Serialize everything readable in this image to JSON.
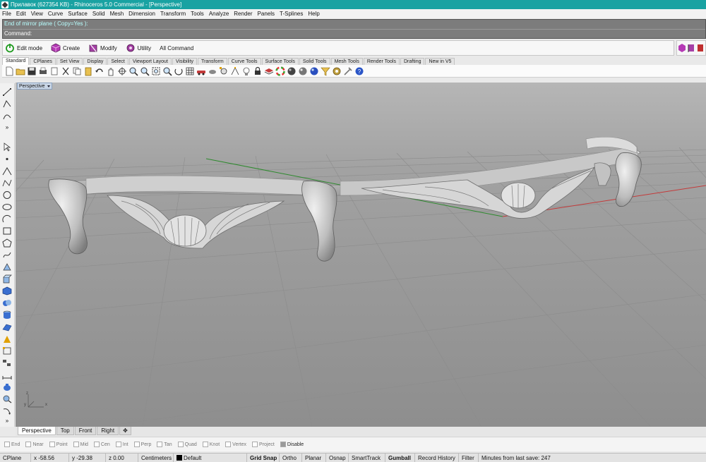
{
  "window": {
    "title": "Прилавок (627354 KB) - Rhinoceros 5.0 Commercial - [Perspective]"
  },
  "menu": [
    "File",
    "Edit",
    "View",
    "Curve",
    "Surface",
    "Solid",
    "Mesh",
    "Dimension",
    "Transform",
    "Tools",
    "Analyze",
    "Render",
    "Panels",
    "T-Splines",
    "Help"
  ],
  "command": {
    "history": "End of mirror plane ( Copy=Yes ):",
    "prompt": "Command:"
  },
  "modes": {
    "edit": "Edit mode",
    "create": "Create",
    "modify": "Modify",
    "utility": "Utility",
    "all": "All Command"
  },
  "tabs": [
    "Standard",
    "CPlanes",
    "Set View",
    "Display",
    "Select",
    "Viewport Layout",
    "Visibility",
    "Transform",
    "Curve Tools",
    "Surface Tools",
    "Solid Tools",
    "Mesh Tools",
    "Render Tools",
    "Drafting",
    "New in V5"
  ],
  "viewport": {
    "label": "Perspective",
    "axis_x": "x",
    "axis_y": "y",
    "axis_z": "z"
  },
  "view_tabs": [
    "Perspective",
    "Top",
    "Front",
    "Right"
  ],
  "osnaps": [
    {
      "label": "End",
      "on": false
    },
    {
      "label": "Near",
      "on": false
    },
    {
      "label": "Point",
      "on": false
    },
    {
      "label": "Mid",
      "on": false
    },
    {
      "label": "Cen",
      "on": false
    },
    {
      "label": "Int",
      "on": false
    },
    {
      "label": "Perp",
      "on": false
    },
    {
      "label": "Tan",
      "on": false
    },
    {
      "label": "Quad",
      "on": false
    },
    {
      "label": "Knot",
      "on": false
    },
    {
      "label": "Vertex",
      "on": false
    },
    {
      "label": "Project",
      "on": false
    },
    {
      "label": "Disable",
      "on": true
    }
  ],
  "status": {
    "cplane": "CPlane",
    "x": "x -58.56",
    "y": "y -29.38",
    "z": "z 0.00",
    "units": "Centimeters",
    "layer": "Default",
    "grid_snap": "Grid Snap",
    "ortho": "Ortho",
    "planar": "Planar",
    "osnap": "Osnap",
    "smarttrack": "SmartTrack",
    "gumball": "Gumball",
    "record_history": "Record History",
    "filter": "Filter",
    "last_save": "Minutes from last save: 247"
  },
  "colors": {
    "titlebar": "#19a2a2",
    "viewport_bg": "#9a9a9a",
    "model": "#d4d4d4",
    "axis_x": "#c43a3a",
    "axis_y": "#2e8a2e"
  }
}
